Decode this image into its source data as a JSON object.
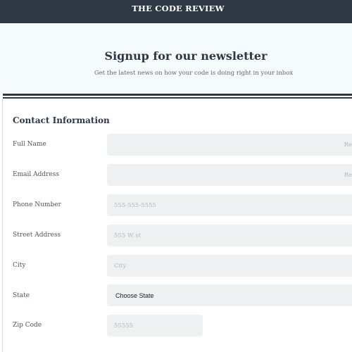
{
  "header": {
    "brand": "THE CODE REVIEW"
  },
  "hero": {
    "title": "Signup for our newsletter",
    "subtitle": "Get the latest news on how your code is doing right in your inbox"
  },
  "form": {
    "section_title": "Contact Information",
    "fields": {
      "full_name": {
        "label": "Full Name",
        "placeholder": "Re",
        "value": ""
      },
      "email": {
        "label": "Email Address",
        "placeholder": "Re",
        "value": ""
      },
      "phone": {
        "label": "Phone Number",
        "placeholder": "555-555-5555",
        "value": ""
      },
      "street": {
        "label": "Street Address",
        "placeholder": "555 W st",
        "value": ""
      },
      "city": {
        "label": "City",
        "placeholder": "City",
        "value": ""
      },
      "state": {
        "label": "State",
        "selected": "Choose State"
      },
      "zip": {
        "label": "Zip Code",
        "placeholder": "55555",
        "value": ""
      }
    }
  },
  "colors": {
    "header_bg": "#2d3844",
    "hero_bg": "#f5fafd",
    "field_bg": "#eff0f1"
  }
}
